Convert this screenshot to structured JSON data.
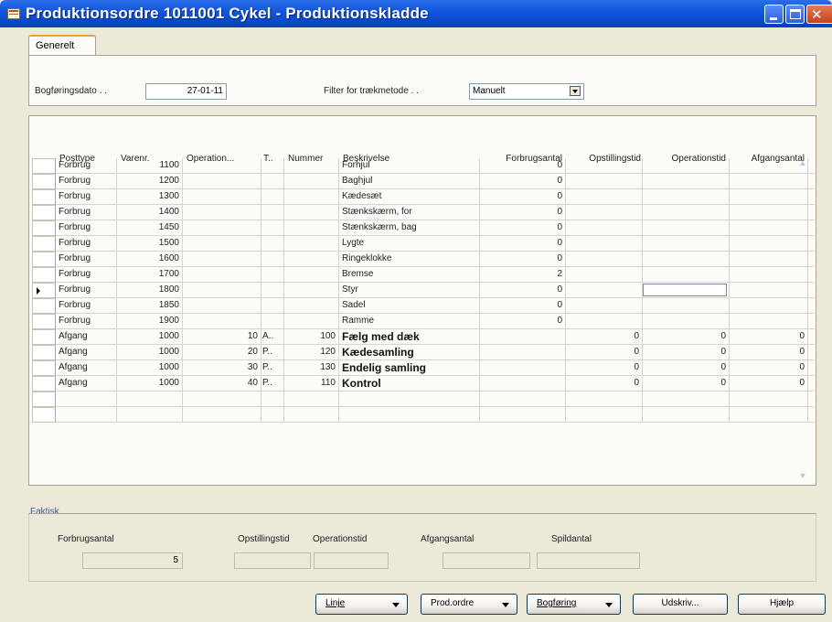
{
  "window": {
    "title": "Produktionsordre 1011001 Cykel - Produktionskladde"
  },
  "tabs": [
    {
      "label": "Generelt"
    }
  ],
  "header_fields": {
    "posting_date_label": "Bogføringsdato . .",
    "posting_date_value": "27-01-11",
    "filter_label": "Filter for trækmetode . .",
    "filter_value": "Manuelt"
  },
  "grid": {
    "columns": [
      "Posttype",
      "Varenr.",
      "Operation...",
      "T..",
      "Nummer",
      "Beskrivelse",
      "Forbrugsantal",
      "Opstillingstid",
      "Operationstid",
      "Afgangsantal"
    ],
    "rows": [
      {
        "type": "Forbrug",
        "item": "1100",
        "op": "",
        "t": "",
        "num": "",
        "desc": "Forhjul",
        "cons": "0",
        "setup": "",
        "run": "",
        "out": ""
      },
      {
        "type": "Forbrug",
        "item": "1200",
        "op": "",
        "t": "",
        "num": "",
        "desc": "Baghjul",
        "cons": "0",
        "setup": "",
        "run": "",
        "out": ""
      },
      {
        "type": "Forbrug",
        "item": "1300",
        "op": "",
        "t": "",
        "num": "",
        "desc": "Kædesæt",
        "cons": "0",
        "setup": "",
        "run": "",
        "out": ""
      },
      {
        "type": "Forbrug",
        "item": "1400",
        "op": "",
        "t": "",
        "num": "",
        "desc": "Stænkskærm, for",
        "cons": "0",
        "setup": "",
        "run": "",
        "out": ""
      },
      {
        "type": "Forbrug",
        "item": "1450",
        "op": "",
        "t": "",
        "num": "",
        "desc": "Stænkskærm, bag",
        "cons": "0",
        "setup": "",
        "run": "",
        "out": ""
      },
      {
        "type": "Forbrug",
        "item": "1500",
        "op": "",
        "t": "",
        "num": "",
        "desc": "Lygte",
        "cons": "0",
        "setup": "",
        "run": "",
        "out": ""
      },
      {
        "type": "Forbrug",
        "item": "1600",
        "op": "",
        "t": "",
        "num": "",
        "desc": "Ringeklokke",
        "cons": "0",
        "setup": "",
        "run": "",
        "out": ""
      },
      {
        "type": "Forbrug",
        "item": "1700",
        "op": "",
        "t": "",
        "num": "",
        "desc": "Bremse",
        "cons": "2",
        "setup": "",
        "run": "",
        "out": ""
      },
      {
        "type": "Forbrug",
        "item": "1800",
        "op": "",
        "t": "",
        "num": "",
        "desc": "Styr",
        "cons": "0",
        "setup": "",
        "run": "",
        "out": ""
      },
      {
        "type": "Forbrug",
        "item": "1850",
        "op": "",
        "t": "",
        "num": "",
        "desc": "Sadel",
        "cons": "0",
        "setup": "",
        "run": "",
        "out": ""
      },
      {
        "type": "Forbrug",
        "item": "1900",
        "op": "",
        "t": "",
        "num": "",
        "desc": "Ramme",
        "cons": "0",
        "setup": "",
        "run": "",
        "out": ""
      },
      {
        "type": "Afgang",
        "item": "1000",
        "op": "10",
        "t": "A..",
        "num": "100",
        "desc": "Fælg med dæk",
        "cons": "",
        "setup": "0",
        "run": "0",
        "out": "0"
      },
      {
        "type": "Afgang",
        "item": "1000",
        "op": "20",
        "t": "P..",
        "num": "120",
        "desc": "Kædesamling",
        "cons": "",
        "setup": "0",
        "run": "0",
        "out": "0"
      },
      {
        "type": "Afgang",
        "item": "1000",
        "op": "30",
        "t": "P..",
        "num": "130",
        "desc": "Endelig samling",
        "cons": "",
        "setup": "0",
        "run": "0",
        "out": "0"
      },
      {
        "type": "Afgang",
        "item": "1000",
        "op": "40",
        "t": "P..",
        "num": "110",
        "desc": "Kontrol",
        "cons": "",
        "setup": "0",
        "run": "0",
        "out": "0"
      }
    ]
  },
  "summary": {
    "section_label": "Faktisk",
    "consumption_label": "Forbrugsantal",
    "consumption_value": "5",
    "setup_label": "Opstillingstid",
    "runtime_label": "Operationstid",
    "output_label": "Afgangsantal",
    "scrap_label": "Spildantal"
  },
  "buttons": {
    "line": "Linje",
    "prod_order": "Prod.ordre",
    "posting": "Bogføring",
    "print": "Udskriv...",
    "help": "Hjælp"
  },
  "colors": {
    "titlebar": "#0a48c7",
    "window_bg": "#ece9d8",
    "tab_accent": "#f0a030"
  }
}
